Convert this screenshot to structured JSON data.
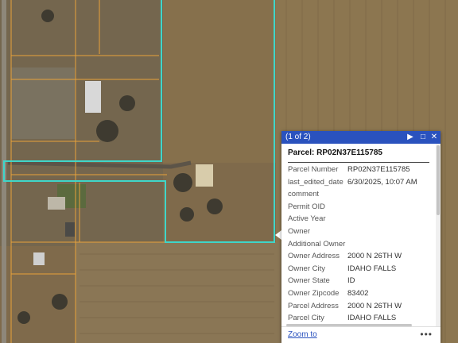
{
  "popup": {
    "counter": "(1 of 2)",
    "title": "Parcel: RP02N37E115785",
    "next_icon": "play-triangle-icon",
    "dock_icon": "dock-square-icon",
    "close_icon": "close-icon",
    "fields": [
      {
        "label": "Parcel Number",
        "value": "RP02N37E115785"
      },
      {
        "label": "last_edited_date",
        "value": "6/30/2025, 10:07 AM"
      },
      {
        "label": "comment",
        "value": ""
      },
      {
        "label": "Permit OID",
        "value": ""
      },
      {
        "label": "Active Year",
        "value": ""
      },
      {
        "label": "Owner",
        "value": ""
      },
      {
        "label": "Additional Owner",
        "value": ""
      },
      {
        "label": "Owner Address",
        "value": "2000 N 26TH W"
      },
      {
        "label": "Owner City",
        "value": "IDAHO FALLS"
      },
      {
        "label": "Owner State",
        "value": "ID"
      },
      {
        "label": "Owner Zipcode",
        "value": "83402"
      },
      {
        "label": "Parcel Address",
        "value": "2000 N 26TH W"
      },
      {
        "label": "Parcel City",
        "value": "IDAHO FALLS"
      }
    ],
    "zoom_label": "Zoom to",
    "more_label": "•••"
  },
  "colors": {
    "header": "#2a52be",
    "selected_parcel_outline": "#3fd6c9",
    "parcel_lines": "#e8a23a",
    "field_brown": "#8a7350",
    "field_dark": "#6e5a3c"
  }
}
